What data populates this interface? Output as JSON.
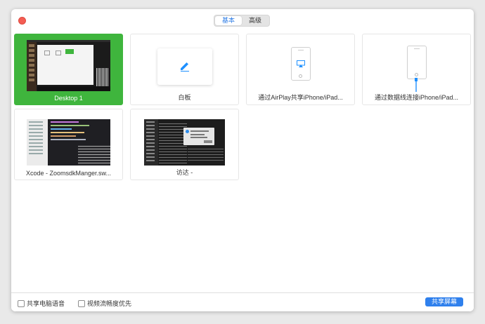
{
  "tabs": [
    {
      "label": "基本",
      "active": true
    },
    {
      "label": "高级",
      "active": false
    }
  ],
  "tiles": [
    {
      "label": "Desktop 1",
      "icon": "desktop-thumbnail",
      "selected": true
    },
    {
      "label": "白板",
      "icon": "pencil-icon",
      "selected": false
    },
    {
      "label": "通过AirPlay共享iPhone/iPad...",
      "icon": "airplay-icon",
      "selected": false
    },
    {
      "label": "通过数据线连接iPhone/iPad...",
      "icon": "cable-icon",
      "selected": false
    },
    {
      "label": "Xcode - ZoomsdkManger.sw...",
      "icon": "xcode-window-thumbnail",
      "selected": false
    },
    {
      "label": "访达 -",
      "icon": "finder-window-thumbnail",
      "selected": false
    }
  ],
  "footer": {
    "share_audio_label": "共享电脑语音",
    "optimize_video_label": "视频流畅度优先",
    "share_button_label": "共享屏幕"
  },
  "colors": {
    "selected_tile": "#3fb53d",
    "primary_button": "#2f80ed",
    "accent_blue": "#1e90ff",
    "close_button": "#f45d53"
  }
}
